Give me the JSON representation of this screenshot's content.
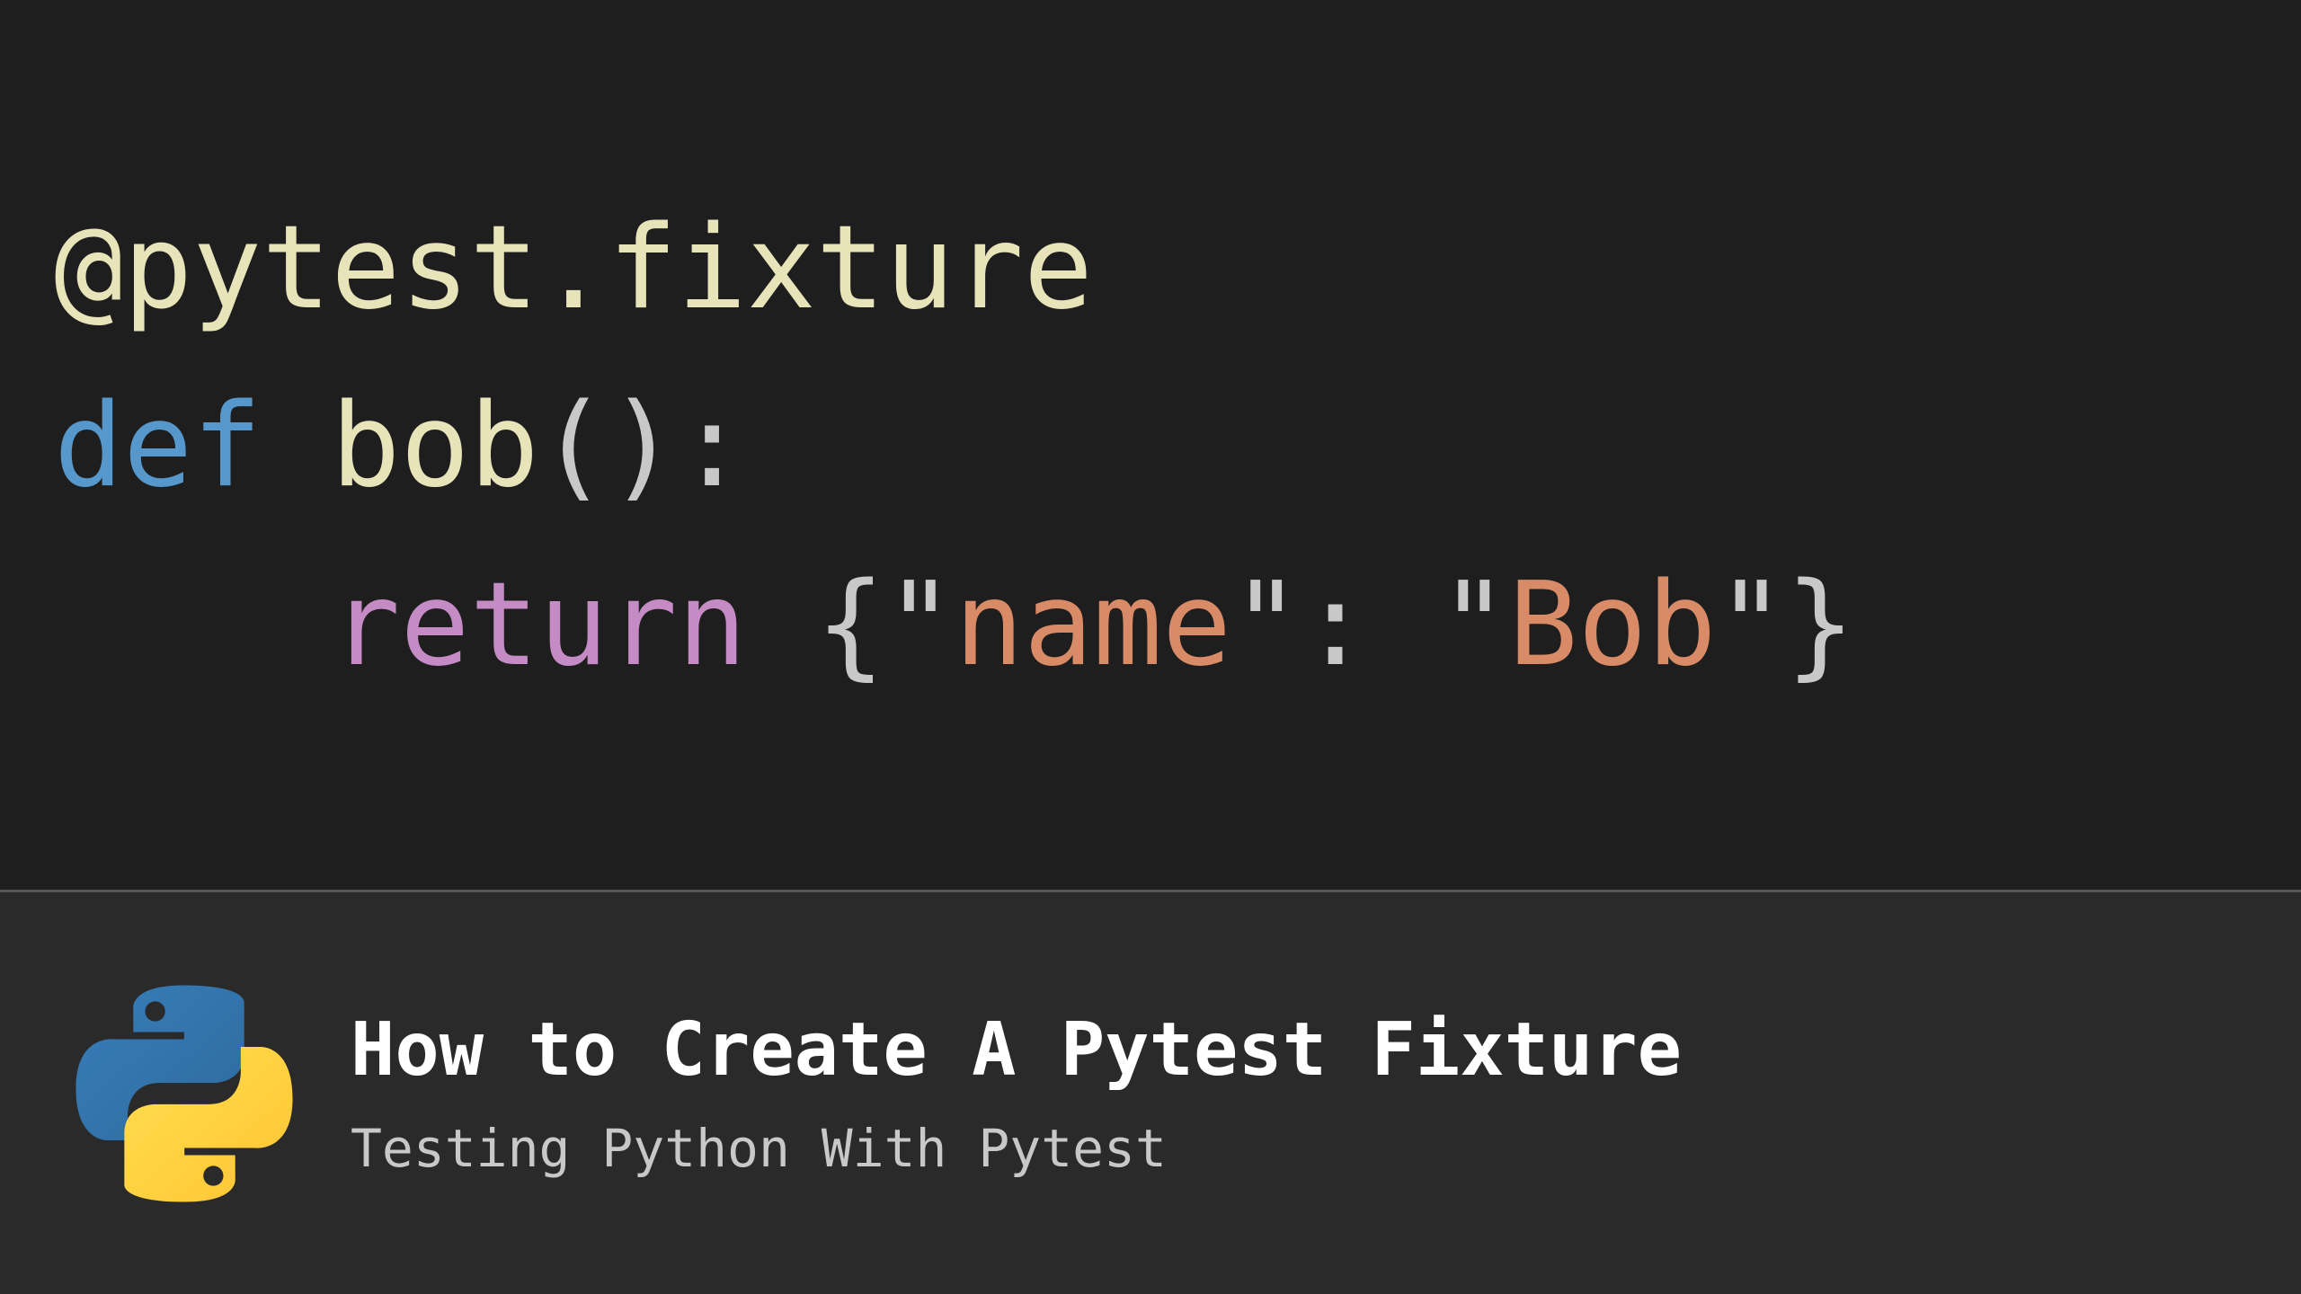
{
  "code": {
    "line1": {
      "decorator": "@pytest.fixture"
    },
    "line2": {
      "def": "def",
      "name": "bob",
      "parens": "()",
      "colon": ":"
    },
    "line3": {
      "indent": "    ",
      "return": "return",
      "space": " ",
      "lbrace": "{",
      "q1": "\"",
      "key": "name",
      "q2": "\"",
      "colon2": ":",
      "space2": " ",
      "q3": "\"",
      "val": "Bob",
      "q4": "\"",
      "rbrace": "}"
    }
  },
  "footer": {
    "title": "How to Create A Pytest Fixture",
    "subtitle": "Testing Python With Pytest",
    "logo_name": "python-logo"
  }
}
